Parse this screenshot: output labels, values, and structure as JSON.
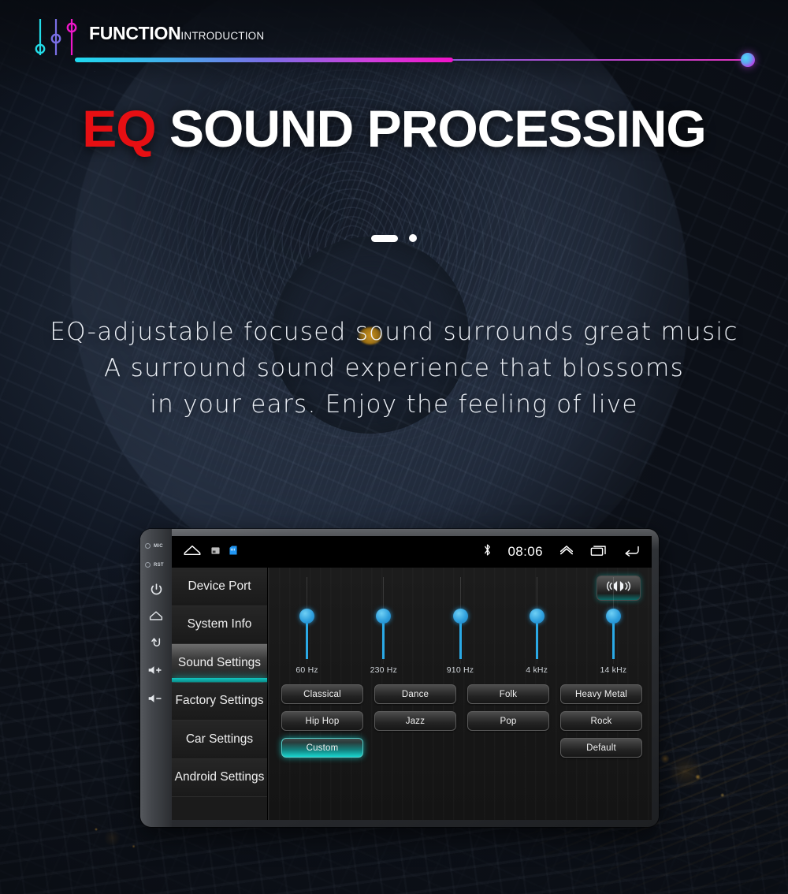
{
  "header": {
    "title_bold": "FUNCTION",
    "title_light": "INTRODUCTION",
    "accent_cyan": "#1fd9ef",
    "accent_magenta": "#f012c8",
    "eq_icon": "equalizer-sliders-icon"
  },
  "hero": {
    "title_accent": "EQ",
    "title_rest": " SOUND PROCESSING",
    "accent_red": "#e60f13",
    "subtitle_lines": [
      "EQ-adjustable focused sound surrounds great music",
      "A surround sound experience that blossoms",
      "in your ears. Enjoy the feeling of live"
    ]
  },
  "device": {
    "bezel_labels": {
      "mic": "MIC",
      "rst": "RST"
    },
    "bezel_buttons": [
      {
        "name": "power-button",
        "glyph": "power-icon"
      },
      {
        "name": "home-button",
        "glyph": "home-icon"
      },
      {
        "name": "back-button",
        "glyph": "back-arrow-icon"
      },
      {
        "name": "volume-up-button",
        "glyph": "volume-up-icon"
      },
      {
        "name": "volume-down-button",
        "glyph": "volume-down-icon"
      }
    ],
    "statusbar": {
      "home_icon": "home-icon",
      "screenshot_icon": "screenshot-icon",
      "sdcard_icon": "sd-card-icon",
      "bluetooth_icon": "bluetooth-icon",
      "time": "08:06",
      "expand_icon": "chevron-up-icon",
      "recents_icon": "recent-apps-icon",
      "back_icon": "back-arrow-icon"
    },
    "menu": {
      "items": [
        {
          "label": "Device Port",
          "selected": false
        },
        {
          "label": "System Info",
          "selected": false
        },
        {
          "label": "Sound Settings",
          "selected": true
        },
        {
          "label": "Factory Settings",
          "selected": false
        },
        {
          "label": "Car Settings",
          "selected": false
        },
        {
          "label": "Android Settings",
          "selected": false
        }
      ],
      "selected_accent": "#12c7c0"
    },
    "sound_panel": {
      "loudness_button": {
        "name": "loudness-button",
        "icon": "loudness-speakers-icon",
        "active": true
      },
      "equalizer": {
        "bands": [
          {
            "label": "60 Hz",
            "position_pct": 50
          },
          {
            "label": "230 Hz",
            "position_pct": 50
          },
          {
            "label": "910 Hz",
            "position_pct": 50
          },
          {
            "label": "4 kHz",
            "position_pct": 50
          },
          {
            "label": "14 kHz",
            "position_pct": 50
          }
        ],
        "knob_color": "#2f9fdd"
      },
      "presets": [
        {
          "label": "Classical",
          "selected": false
        },
        {
          "label": "Dance",
          "selected": false
        },
        {
          "label": "Folk",
          "selected": false
        },
        {
          "label": "Heavy Metal",
          "selected": false
        },
        {
          "label": "Hip Hop",
          "selected": false
        },
        {
          "label": "Jazz",
          "selected": false
        },
        {
          "label": "Pop",
          "selected": false
        },
        {
          "label": "Rock",
          "selected": false
        },
        {
          "label": "Custom",
          "selected": true
        },
        {
          "label": "",
          "selected": false,
          "hidden": true
        },
        {
          "label": "",
          "selected": false,
          "hidden": true
        },
        {
          "label": "Default",
          "selected": false
        }
      ],
      "selected_preset_accent": "#19d4ce"
    }
  }
}
